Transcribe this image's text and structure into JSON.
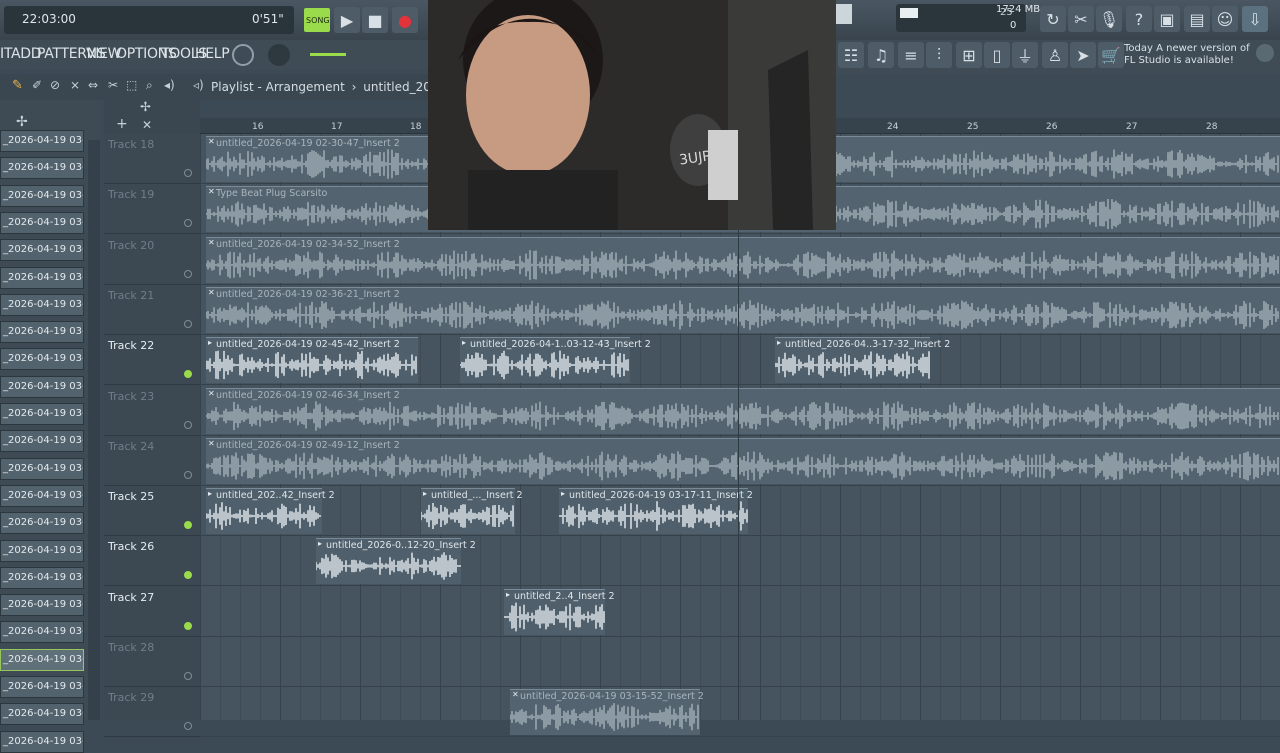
{
  "transport": {
    "time": "22:03:00",
    "song_time": "0'51\"",
    "mode_label": "SONG",
    "tempo": "25",
    "memory": "1724 MB",
    "memory_sub": "0"
  },
  "menu": {
    "items": [
      "IT",
      "ADD",
      "PATTERNS",
      "VIEW",
      "OPTIONS",
      "TOOLS",
      "HELP"
    ]
  },
  "news": {
    "line1": "Today  A newer version of",
    "line2": "FL Studio is available!"
  },
  "playlist": {
    "breadcrumb": "Playlist - Arrangement",
    "separator": "›",
    "file": "untitled_2026-0"
  },
  "channels": {
    "label": "_2026-04-19 03-...",
    "count": 23,
    "selected_index": 19
  },
  "ruler": {
    "left": [
      "16",
      "17",
      "18"
    ],
    "right": [
      "24",
      "25",
      "26",
      "27",
      "28"
    ]
  },
  "tracks": [
    {
      "name": "Track 18",
      "active": false,
      "clips": [
        {
          "label": "untitled_2026-04-19 02-30-47_Insert 2",
          "icon": "x-icon"
        }
      ]
    },
    {
      "name": "Track 19",
      "active": false,
      "clips": [
        {
          "label": "Type Beat Plug Scarsito",
          "icon": "x-icon"
        }
      ]
    },
    {
      "name": "Track 20",
      "active": false,
      "clips": [
        {
          "label": "untitled_2026-04-19 02-34-52_Insert 2",
          "icon": "x-icon"
        }
      ]
    },
    {
      "name": "Track 21",
      "active": false,
      "clips": [
        {
          "label": "untitled_2026-04-19 02-36-21_Insert 2",
          "icon": "x-icon"
        }
      ]
    },
    {
      "name": "Track 22",
      "active": true,
      "clips": [
        {
          "label": "untitled_2026-04-19 02-45-42_Insert 2",
          "icon": "play-icon"
        },
        {
          "label": "untitled_2026-04-1..03-12-43_Insert 2",
          "icon": "play-icon"
        },
        {
          "label": "untitled_2026-04..3-17-32_Insert 2",
          "icon": "play-icon"
        }
      ]
    },
    {
      "name": "Track 23",
      "active": false,
      "clips": [
        {
          "label": "untitled_2026-04-19 02-46-34_Insert 2",
          "icon": "x-icon"
        }
      ]
    },
    {
      "name": "Track 24",
      "active": false,
      "clips": [
        {
          "label": "untitled_2026-04-19 02-49-12_Insert 2",
          "icon": "x-icon"
        }
      ]
    },
    {
      "name": "Track 25",
      "active": true,
      "clips": [
        {
          "label": "untitled_202..42_Insert 2",
          "icon": "play-icon"
        },
        {
          "label": "untitled_..._Insert 2",
          "icon": "play-icon"
        },
        {
          "label": "untitled_2026-04-19 03-17-11_Insert 2",
          "icon": "play-icon"
        }
      ]
    },
    {
      "name": "Track 26",
      "active": true,
      "clips": [
        {
          "label": "untitled_2026-0..12-20_Insert 2",
          "icon": "play-icon"
        }
      ]
    },
    {
      "name": "Track 27",
      "active": true,
      "clips": [
        {
          "label": "untitled_2..4_Insert 2",
          "icon": "play-icon"
        }
      ]
    },
    {
      "name": "Track 28",
      "active": false,
      "clips": []
    },
    {
      "name": "Track 29",
      "active": false,
      "clips": [
        {
          "label": "untitled_2026-04-19 03-15-52_Insert 2",
          "icon": "x-icon"
        }
      ]
    }
  ],
  "webcam": {
    "mic_brand": "3UJR8"
  }
}
